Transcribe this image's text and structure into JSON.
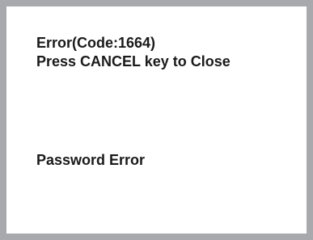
{
  "dialog": {
    "error_line": "Error(Code:1664)",
    "close_hint": "Press CANCEL key to Close",
    "detail": "Password Error"
  },
  "colors": {
    "frame": "#a7a9ac",
    "background": "#ffffff",
    "text": "#1a1a1a"
  }
}
